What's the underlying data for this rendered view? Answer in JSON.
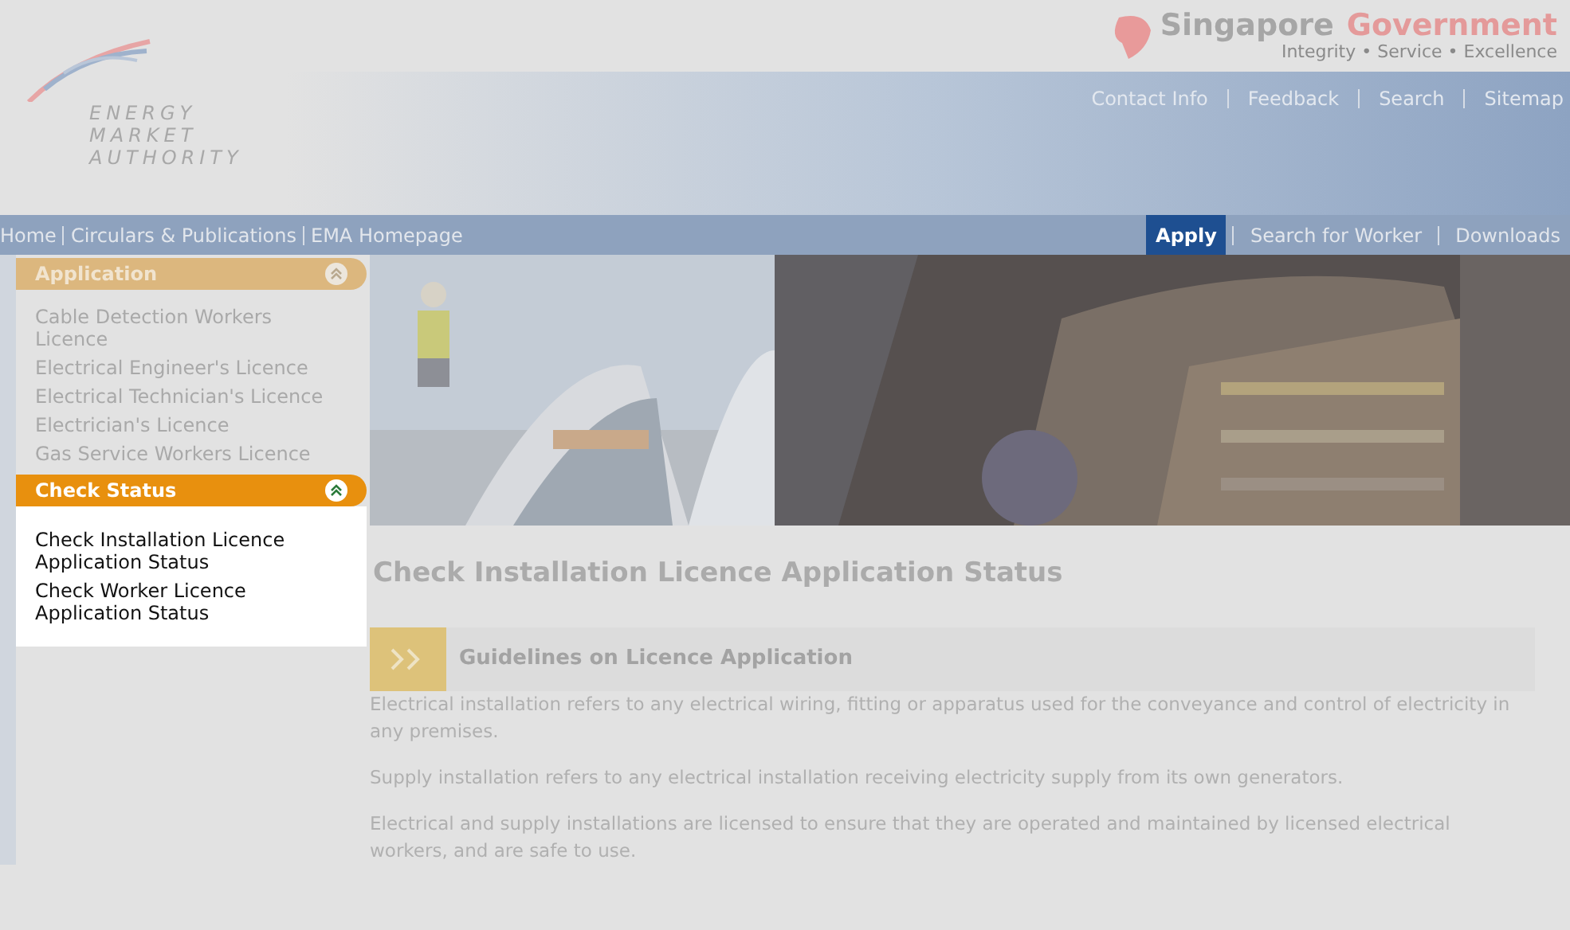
{
  "logo": {
    "lines": [
      "ENERGY",
      "MARKET",
      "AUTHORITY"
    ]
  },
  "gov_banner": {
    "title_first": "Singapore",
    "title_second": "Government",
    "tagline": "Integrity • Service • Excellence"
  },
  "utility_links": [
    "Contact Info",
    "Feedback",
    "Search",
    "Sitemap"
  ],
  "nav_left": [
    {
      "label": "Home"
    },
    {
      "label": "Circulars & Publications"
    },
    {
      "label": "EMA Homepage"
    }
  ],
  "nav_right": [
    {
      "label": "Apply",
      "selected": true
    },
    {
      "label": "Search for Worker",
      "selected": false
    },
    {
      "label": "Downloads",
      "selected": false
    }
  ],
  "sidebar": [
    {
      "title": "Application",
      "highlighted": false,
      "items": [
        "Cable Detection Workers Licence",
        "Electrical Engineer's Licence",
        "Electrical Technician's Licence",
        "Electrician's Licence",
        "Gas Service Workers Licence"
      ]
    },
    {
      "title": "Check Status",
      "highlighted": true,
      "items": [
        "Check Installation Licence Application Status",
        "Check Worker Licence Application Status"
      ]
    }
  ],
  "page_title": "Check Installation Licence Application Status",
  "section": {
    "title": "Guidelines on Licence Application",
    "paragraphs": [
      "Electrical installation refers to any electrical wiring, fitting or apparatus used for the conveyance and control of electricity in any premises.",
      "Supply installation refers to any electrical installation receiving electricity supply from its own generators.",
      "Electrical and supply installations are licensed to ensure that they are operated and maintained by licensed electrical workers, and are safe to use."
    ]
  }
}
